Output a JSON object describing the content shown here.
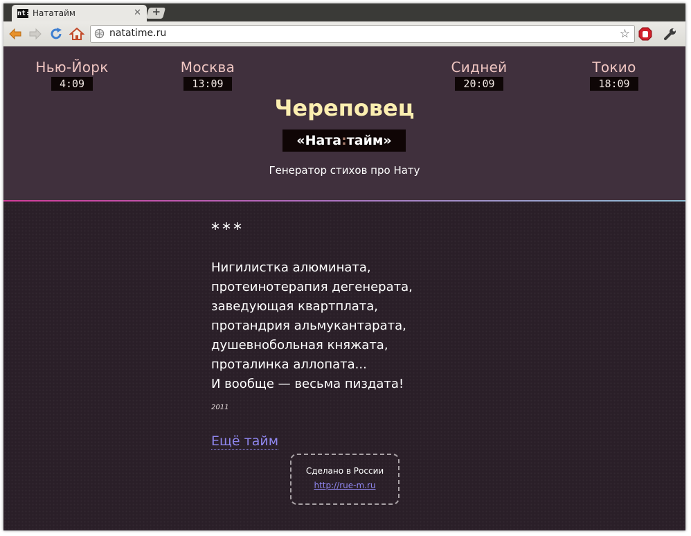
{
  "browser": {
    "tab": {
      "favicon": "nt:",
      "title": "Нататайм",
      "close": "✕"
    },
    "new_tab": "+",
    "url": "natatime.ru",
    "icons": {
      "back": "back-arrow-icon",
      "forward": "forward-arrow-icon",
      "reload": "reload-icon",
      "home": "home-icon",
      "globe": "globe-icon",
      "bookmark": "bookmark-star-icon",
      "adblock": "adblock-icon",
      "settings": "wrench-icon"
    }
  },
  "clocks": [
    {
      "city": "Нью-Йорк",
      "time": "4:09"
    },
    {
      "city": "Москва",
      "time": "13:09"
    },
    {
      "city": "Сидней",
      "time": "20:09"
    },
    {
      "city": "Токио",
      "time": "18:09"
    }
  ],
  "main_city": "Череповец",
  "logo": {
    "left": "«Ната",
    "colon": ":",
    "right": "тайм»"
  },
  "tagline": "Генератор стихов про Нату",
  "poem": {
    "heading": "***",
    "lines": [
      "Нигилистка алюмината,",
      "протеинотерапия дегенерата,",
      "заведующая квартплата,",
      "протандрия альмукантарата,",
      "душевнобольная княжата,",
      "проталинка аллопата...",
      "И вообще — весьма пиздата!"
    ],
    "year": "2011"
  },
  "more_link": "Ещё тайм",
  "footer": {
    "label": "Сделано в России",
    "link": "http://rue-m.ru"
  },
  "colors": {
    "header_bg": "#40303d",
    "content_bg": "#2a1f28",
    "city_name": "#f0c6c2",
    "main_city": "#fbeeb0",
    "link": "#8f86ee"
  }
}
